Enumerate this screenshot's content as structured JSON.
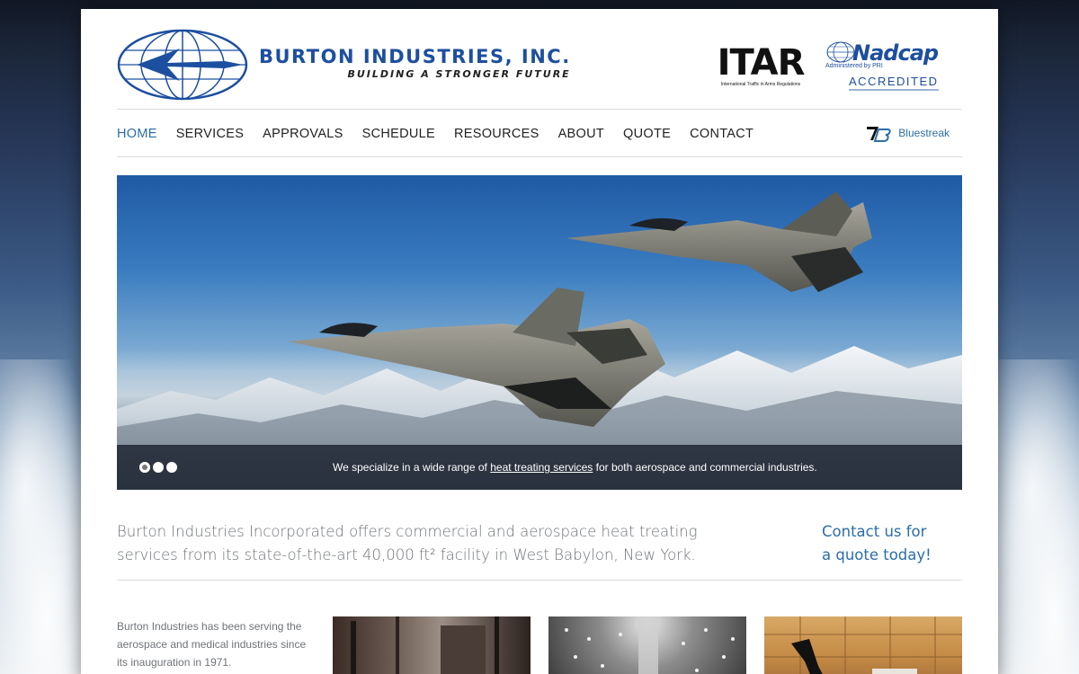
{
  "brand": {
    "name": "BURTON INDUSTRIES, INC.",
    "tagline": "BUILDING A STRONGER FUTURE",
    "color": "#1d4fa0"
  },
  "badges": {
    "itar": {
      "word": "ITAR",
      "sub": "International Traffic in Arms Regulations"
    },
    "nadcap": {
      "word": "Nadcap",
      "admin": "Administered by PRI",
      "status": "ACCREDITED"
    }
  },
  "nav": {
    "items": [
      {
        "label": "HOME",
        "active": true
      },
      {
        "label": "SERVICES",
        "active": false
      },
      {
        "label": "APPROVALS",
        "active": false
      },
      {
        "label": "SCHEDULE",
        "active": false
      },
      {
        "label": "RESOURCES",
        "active": false
      },
      {
        "label": "ABOUT",
        "active": false
      },
      {
        "label": "QUOTE",
        "active": false
      },
      {
        "label": "CONTACT",
        "active": false
      }
    ],
    "bluestreak": "Bluestreak",
    "active_color": "#2b6ea8"
  },
  "slider": {
    "caption_before": "We specialize in a wide range of ",
    "caption_link": "heat treating services",
    "caption_after": " for both aerospace and commercial industries.",
    "slides": 3,
    "current_slide": 1
  },
  "intro": {
    "text_line1": "Burton Industries Incorporated offers commercial and aerospace heat treating",
    "text_line2": "services from its state-of-the-art 40,000 ft² facility in West Babylon, New York.",
    "cta_line1": "Contact us for",
    "cta_line2": "a quote today!"
  },
  "about": {
    "line1": "Burton Industries has been serving the",
    "line2": "aerospace and medical industries since",
    "line3": "its inauguration in 1971."
  }
}
